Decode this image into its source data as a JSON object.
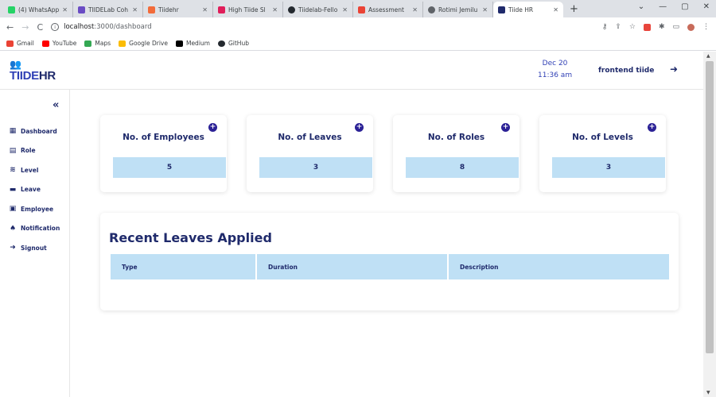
{
  "browser": {
    "tabs": [
      {
        "label": "(4) WhatsApp",
        "color": "#25d366",
        "active": false
      },
      {
        "label": "TIIDELab Coh",
        "color": "#6a4cc4",
        "active": false
      },
      {
        "label": "Tiidehr",
        "color": "#f26b3a",
        "active": false
      },
      {
        "label": "High Tiide Sl",
        "color": "#e01e5a",
        "active": false
      },
      {
        "label": "Tiidelab-Fello",
        "color": "#24292f",
        "active": false
      },
      {
        "label": "Assessment",
        "color": "#ea4335",
        "active": false
      },
      {
        "label": "Rotimi Jemilu",
        "color": "#5f6368",
        "active": false
      },
      {
        "label": "Tiide HR",
        "color": "#1f2a6b",
        "active": true
      }
    ],
    "url_host": "localhost",
    "url_path": ":3000/dashboard",
    "bookmarks": [
      {
        "label": "Gmail",
        "color": "#ea4335"
      },
      {
        "label": "YouTube",
        "color": "#ff0000"
      },
      {
        "label": "Maps",
        "color": "#34a853"
      },
      {
        "label": "Google Drive",
        "color": "#fbbc04"
      },
      {
        "label": "Medium",
        "color": "#000000"
      },
      {
        "label": "GitHub",
        "color": "#24292f"
      }
    ]
  },
  "header": {
    "brand_prefix": "TIIDE",
    "brand_suffix": "HR",
    "date": "Dec 20",
    "time": "11:36 am",
    "user": "frontend tiide"
  },
  "sidebar": {
    "items": [
      {
        "label": "Dashboard",
        "icon": "table-icon"
      },
      {
        "label": "Role",
        "icon": "briefcase-icon"
      },
      {
        "label": "Level",
        "icon": "layers-icon"
      },
      {
        "label": "Leave",
        "icon": "bed-icon"
      },
      {
        "label": "Employee",
        "icon": "id-card-icon"
      },
      {
        "label": "Notification",
        "icon": "bell-icon"
      },
      {
        "label": "Signout",
        "icon": "sign-out-icon"
      }
    ]
  },
  "stats": [
    {
      "title": "No. of Employees",
      "value": "5"
    },
    {
      "title": "No. of Leaves",
      "value": "3"
    },
    {
      "title": "No. of Roles",
      "value": "8"
    },
    {
      "title": "No. of Levels",
      "value": "3"
    }
  ],
  "recent_leaves": {
    "title": "Recent Leaves Applied",
    "columns": [
      "Type",
      "Duration",
      "Description"
    ]
  },
  "colors": {
    "navy": "#1f2a6b",
    "accent_blue": "#2f3fb5",
    "light_blue": "#bfe0f5",
    "plus_purple": "#2b2196"
  }
}
